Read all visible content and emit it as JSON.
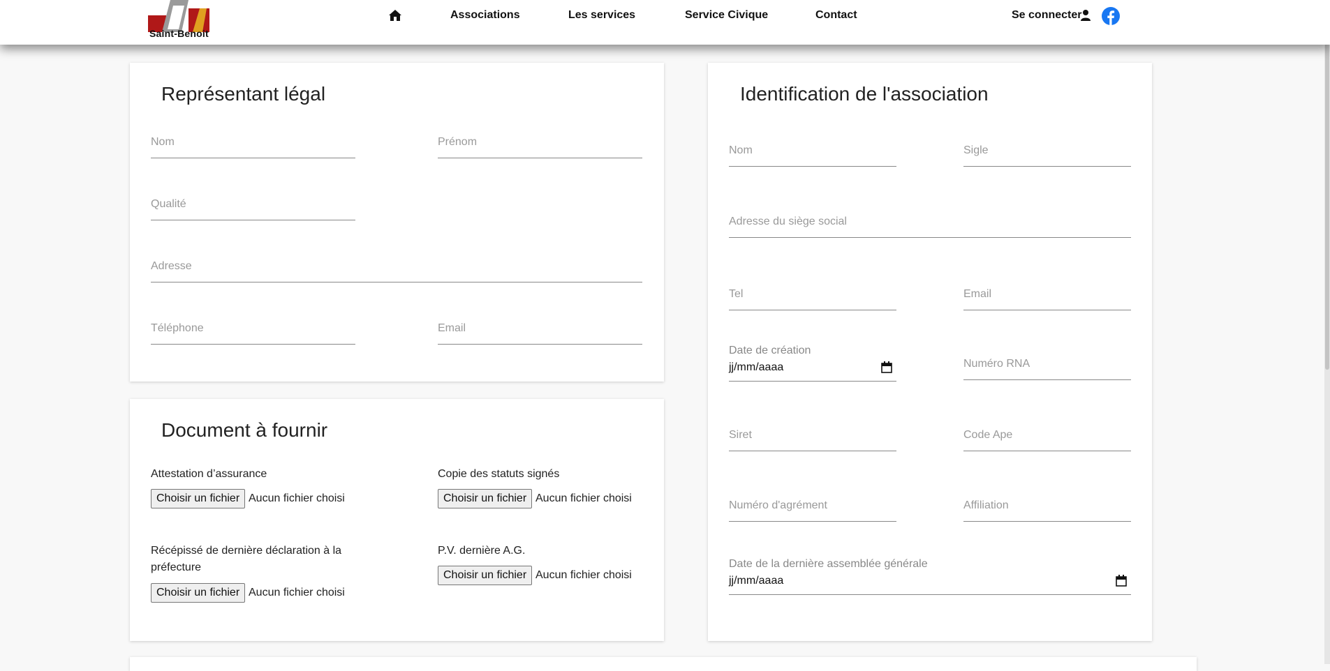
{
  "header": {
    "logo_text": "Saint-Benoit",
    "nav": {
      "home_icon": "home-icon",
      "associations": "Associations",
      "services": "Les services",
      "civic_service": "Service Civique",
      "contact": "Contact"
    },
    "login_label": "Se connecter",
    "user_icon": "user-icon",
    "facebook_icon": "facebook-icon",
    "colors": {
      "facebook": "#1877f2",
      "logo_red": "#b01818",
      "logo_gold": "#e0a020"
    }
  },
  "legal_rep": {
    "title": "Représentant légal",
    "nom": "Nom",
    "prenom": "Prénom",
    "qualite": "Qualité",
    "adresse": "Adresse",
    "telephone": "Téléphone",
    "email": "Email"
  },
  "documents": {
    "title": "Document à fournir",
    "button_label": "Choisir un fichier",
    "no_file": "Aucun fichier choisi",
    "items": [
      {
        "label": "Attestation d’assurance"
      },
      {
        "label": "Copie des statuts signés"
      },
      {
        "label": "Récépissé de dernière déclaration à la préfecture"
      },
      {
        "label": "P.V. dernière A.G."
      }
    ]
  },
  "association": {
    "title": "Identification de l'association",
    "nom": "Nom",
    "sigle": "Sigle",
    "adresse": "Adresse du siège social",
    "tel": "Tel",
    "email": "Email",
    "date_creation_label": "Date de création",
    "date_placeholder": "jj/mm/aaaa",
    "rna": "Numéro RNA",
    "siret": "Siret",
    "code_ape": "Code Ape",
    "agrement": "Numéro d'agrément",
    "affiliation": "Affiliation",
    "date_ag_label": "Date de la dernière assemblée générale"
  }
}
